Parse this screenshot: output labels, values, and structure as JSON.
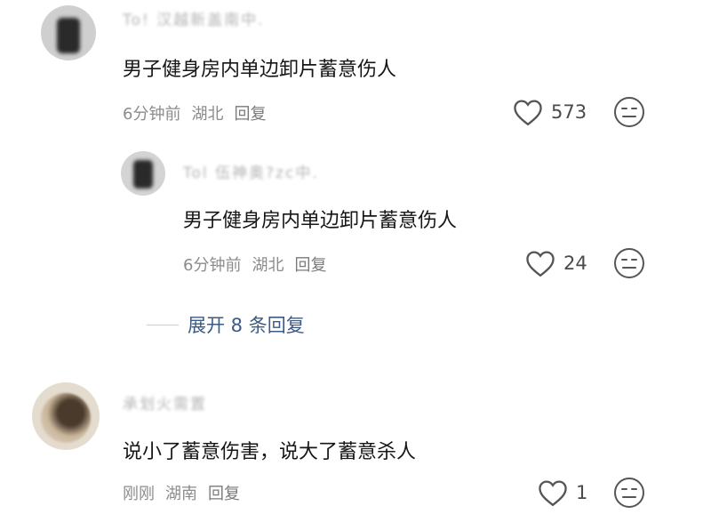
{
  "comments": [
    {
      "username": "To! 汉越新盖南中.",
      "content": "男子健身房内单边卸片蓄意伤人",
      "time": "6分钟前",
      "location": "湖北",
      "reply_label": "回复",
      "likes": "573"
    }
  ],
  "replies": [
    {
      "username": "Tol 伍神奥?zc中.",
      "content": "男子健身房内单边卸片蓄意伤人",
      "time": "6分钟前",
      "location": "湖北",
      "reply_label": "回复",
      "likes": "24"
    }
  ],
  "expand_replies": "展开 8 条回复",
  "comment2": {
    "username": "承划火需置",
    "content": "说小了蓄意伤害，说大了蓄意杀人",
    "time": "刚刚",
    "location": "湖南",
    "reply_label": "回复",
    "likes": "1"
  },
  "icons": {
    "like": "heart-outline-icon",
    "dislike": "neutral-face-icon"
  },
  "colors": {
    "link": "#3d5a84",
    "meta": "#8c8c8c"
  }
}
